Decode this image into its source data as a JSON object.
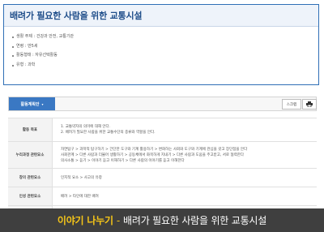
{
  "header": {
    "title": "배려가 필요한 사람을 위한 교통시설",
    "meta": [
      "생활 주제 : 건강과 안전, 교통기관",
      "연령 : 만5세",
      "활동형태 : 자유선택활동",
      "유형 : 과학"
    ]
  },
  "toolbar": {
    "activity_label": "활동계획안",
    "activity_caret": "▾",
    "scrap_label": "스크랩"
  },
  "table": {
    "rows": [
      {
        "header": "활동 목표",
        "lines": [
          "1. 교통약자의 의미에 대해 안다.",
          "2. 배려가 필요한 사람을 위한 교통수단의 종류와 역할을 안다."
        ]
      },
      {
        "header": "누리과정 관련요소",
        "lines": [
          "자연탐구 > 과학적 탐구하기 > 간단한 도구와 기계 활용하기 > 변화하는 사회와 도구와 기계에 관심을 갖고 장단점을 안다",
          "사회관계 > 다른 사람과 더불어 생활하기 > 공동체에서 화목하게 지내기 > 다른 사람과 도움을 주고받고, 서로 협력한다",
          "의사소통 > 듣기 > 이야기 듣고 이해하기 > 다른 사람의 이야기를 듣고 이해한다"
        ]
      },
      {
        "header": "창의 관련요소",
        "lines": [
          "인지적 요소 > 사고의 유창"
        ]
      },
      {
        "header": "인성 관련요소",
        "lines": [
          "배려 > 타인에 대한 배려"
        ]
      },
      {
        "header": "",
        "lines": [
          ""
        ]
      }
    ]
  },
  "caption": {
    "accent": "이야기 나누기",
    "separator": "-",
    "rest": "배려가 필요한 사람을 위한 교통시설"
  }
}
